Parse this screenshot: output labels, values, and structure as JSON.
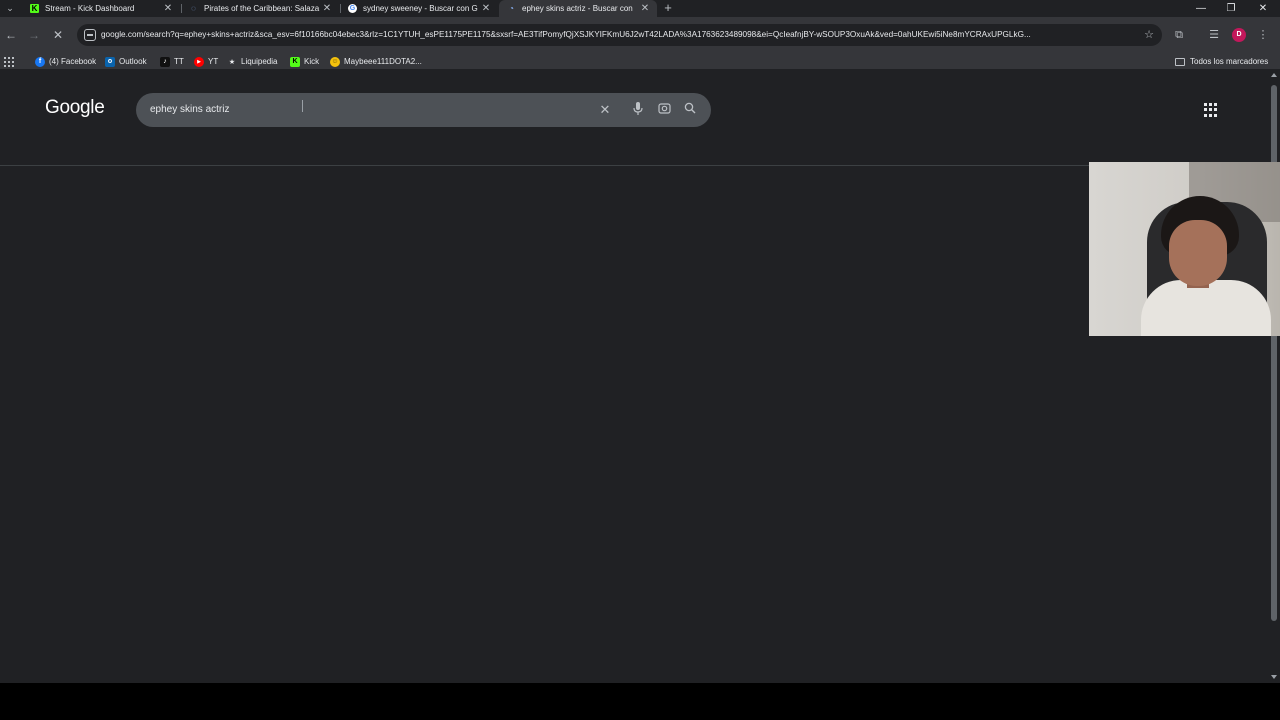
{
  "tabs": [
    {
      "title": "Stream - Kick Dashboard",
      "icon": "kick-icon",
      "active": false
    },
    {
      "title": "Pirates of the Caribbean: Salaza",
      "icon": "page-icon",
      "active": false
    },
    {
      "title": "sydney sweeney - Buscar con G",
      "icon": "google-icon",
      "active": false
    },
    {
      "title": "ephey skins actriz - Buscar con",
      "icon": "loading-icon",
      "active": true
    }
  ],
  "toolbar": {
    "url": "google.com/search?q=ephey+skins+actriz&sca_esv=6f10166bc04ebec3&rlz=1C1YTUH_esPE1175PE1175&sxsrf=AE3TifPomyfQjXSJKYIFKmU6J2wT42LADA%3A1763623489098&ei=QcIeafnjBY-wSOUP3OxuAk&ved=0ahUKEwi5iNe8mYCRAxUPGLkG...",
    "profile_initial": "D"
  },
  "bookmarks": {
    "items": [
      {
        "label": "(4) Facebook",
        "icon": "facebook-icon",
        "color": "#1877f2",
        "glyph": "f"
      },
      {
        "label": "Outlook",
        "icon": "outlook-icon",
        "color": "#0a64ad",
        "glyph": "o"
      },
      {
        "label": "TT",
        "icon": "tiktok-icon",
        "color": "#111111",
        "glyph": "♪"
      },
      {
        "label": "YT",
        "icon": "youtube-icon",
        "color": "#ff0000",
        "glyph": "▶"
      },
      {
        "label": "Liquipedia",
        "icon": "liquipedia-icon",
        "color": "#35363a",
        "glyph": "★"
      },
      {
        "label": "Kick",
        "icon": "kick-icon",
        "color": "#53fc18",
        "glyph": "K"
      },
      {
        "label": "Maybeee111DOTA2...",
        "icon": "emoji-icon",
        "color": "#f4c20d",
        "glyph": "☺"
      }
    ],
    "folder_label": "Todos los marcadores"
  },
  "page": {
    "logo": "Google",
    "search_query": "ephey skins actriz"
  },
  "colors": {
    "page_background": "#202124",
    "toolbar_background": "#35363a",
    "searchbox_background": "#4d5156",
    "kick_green": "#53fc18"
  }
}
